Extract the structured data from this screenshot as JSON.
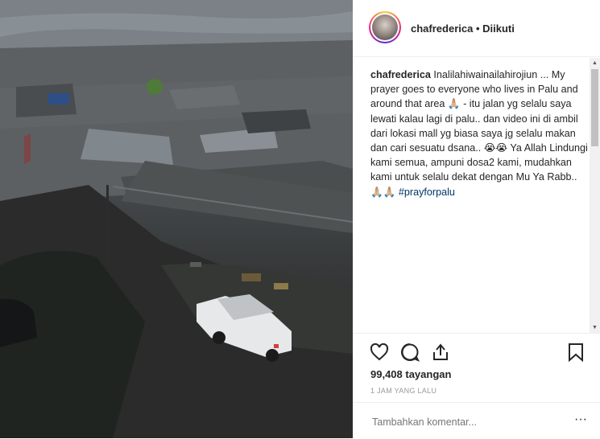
{
  "post": {
    "username": "chafrederica",
    "separator": " • ",
    "follow_status": "Diikuti"
  },
  "caption": {
    "username": "chafrederica",
    "text_main": "Inalilahiwainailahirojiun ... My prayer goes to everyone who lives in Palu and around that area 🙏🏼 - itu jalan yg selalu saya lewati kalau lagi di palu.. dan video ini di ambil dari lokasi mall yg biasa saya jg selalu makan dan cari sesuatu dsana.. 😭😭 Ya Allah Lindungi kami semua, ampuni dosa2 kami, mudahkan kami untuk selalu dekat dengan Mu Ya Rabb.. 🙏🏼🙏🏼 ",
    "hashtag": "#prayforpalu"
  },
  "actions": {
    "like_icon": "heart-icon",
    "comment_icon": "comment-bubble-icon",
    "share_icon": "share-icon",
    "save_icon": "bookmark-icon"
  },
  "stats": {
    "views": "99,408 tayangan",
    "time": "1 JAM YANG LALU"
  },
  "comment": {
    "placeholder": "Tambahkan komentar...",
    "more": "···"
  },
  "colors": {
    "hashtag": "#003569",
    "border": "#efefef",
    "muted": "#999999"
  }
}
